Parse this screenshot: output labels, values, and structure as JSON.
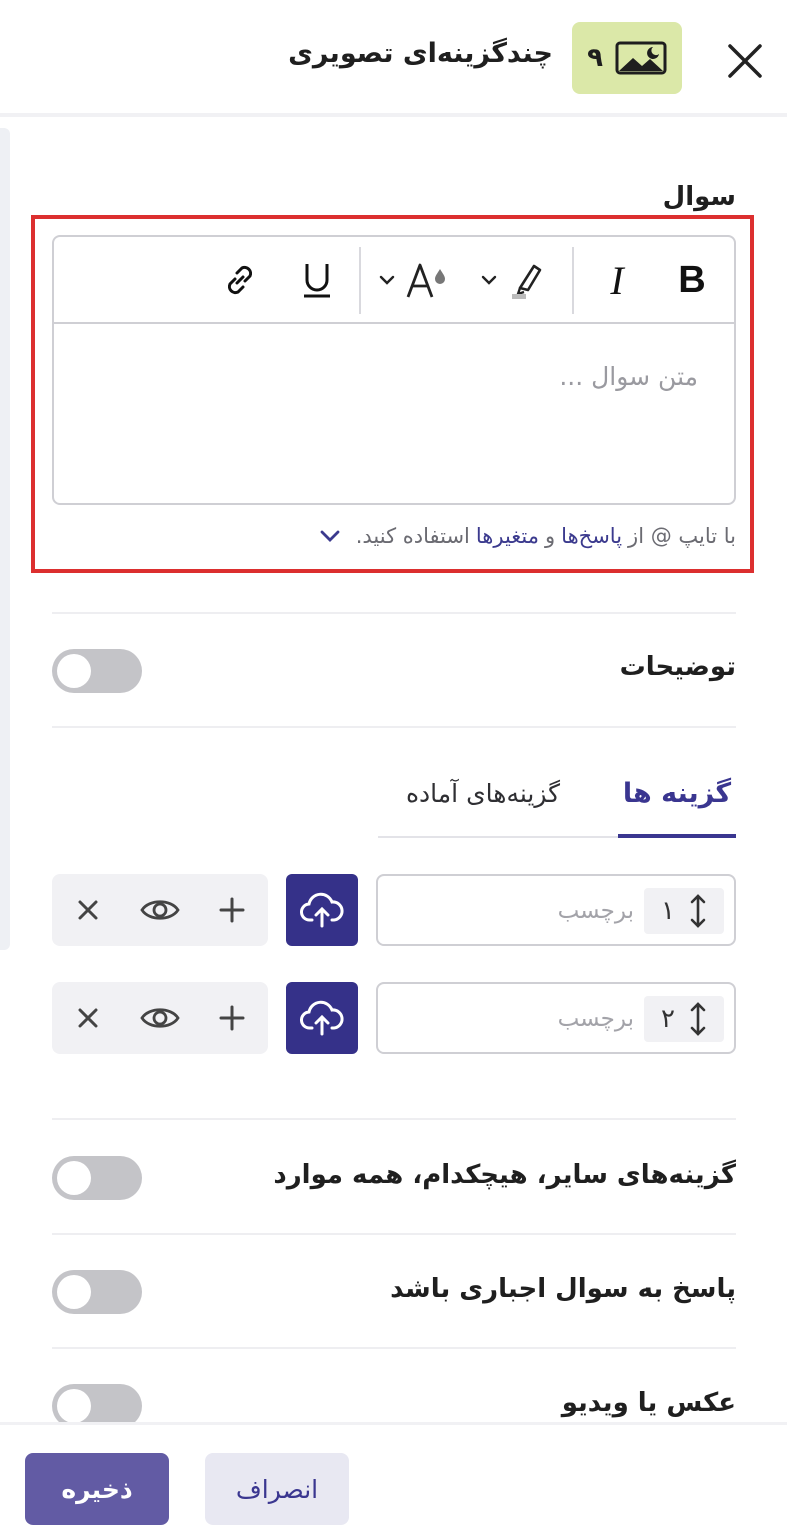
{
  "header": {
    "title": "چندگزینه‌ای تصویری",
    "badge_number": "۹",
    "badge_icon": "image-icon",
    "badge_color": "#dbe8a8"
  },
  "question": {
    "label": "سوال",
    "placeholder": "متن سوال ...",
    "toolbar": [
      "bold-icon",
      "italic-icon",
      "highlight-icon",
      "font-color-icon",
      "underline-icon",
      "link-icon"
    ],
    "hint_prefix": "با تایپ @ از",
    "hint_link1": "پاسخ‌ها",
    "hint_and": "و",
    "hint_link2": "متغیرها",
    "hint_suffix": "استفاده کنید."
  },
  "description": {
    "label": "توضیحات",
    "enabled": false
  },
  "tabs": {
    "active": "گزینه ها",
    "inactive": "گزینه‌های آماده"
  },
  "options": [
    {
      "index": "۱",
      "placeholder": "برچسب"
    },
    {
      "index": "۲",
      "placeholder": "برچسب"
    }
  ],
  "settings": {
    "other_options": {
      "label": "گزینه‌های سایر، هیچکدام، همه موارد",
      "enabled": false
    },
    "required": {
      "label": "پاسخ به سوال اجباری باشد",
      "enabled": false
    },
    "media": {
      "label": "عکس یا ویدیو",
      "enabled": false
    }
  },
  "footer": {
    "save": "ذخیره",
    "cancel": "انصراف"
  },
  "colors": {
    "accent": "#353189",
    "save_button": "#625ba4",
    "highlight_frame": "#dc2f2f"
  }
}
